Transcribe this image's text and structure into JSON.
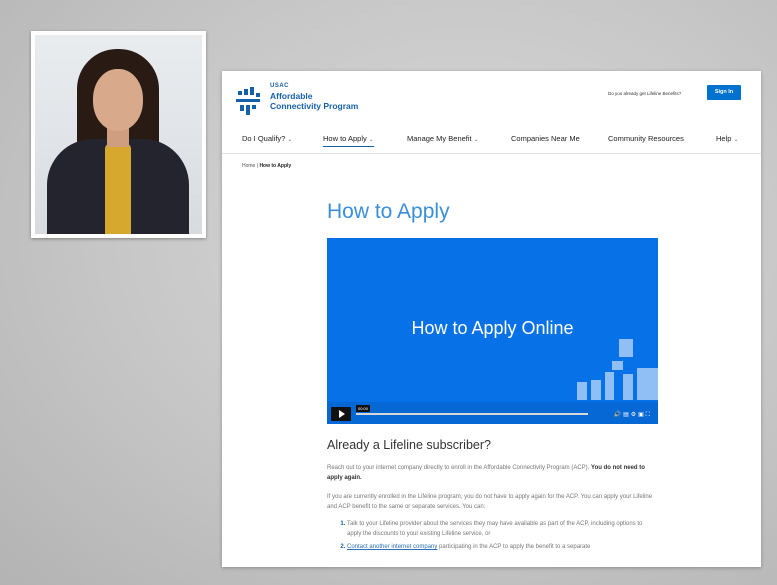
{
  "site": {
    "logo": {
      "org": "USAC",
      "name_line1": "Affordable",
      "name_line2": "Connectivity Program"
    },
    "header_prompt": "Do you already get Lifeline Benefits?",
    "sign_in_label": "Sign In"
  },
  "nav": {
    "items": [
      {
        "label": "Do I Qualify?",
        "dropdown": true
      },
      {
        "label": "How to Apply",
        "dropdown": true,
        "active": true
      },
      {
        "label": "Manage My Benefit",
        "dropdown": true
      },
      {
        "label": "Companies Near Me",
        "dropdown": false
      },
      {
        "label": "Community Resources",
        "dropdown": false
      },
      {
        "label": "Help",
        "dropdown": true
      }
    ]
  },
  "breadcrumb": {
    "home": "Home",
    "separator": "|",
    "current": "How to Apply"
  },
  "main": {
    "title": "How to Apply",
    "video": {
      "title": "How to Apply Online",
      "time": "00:00"
    },
    "section_heading": "Already a Lifeline subscriber?",
    "para1_text": "Reach out to your internet company directly to enroll in the Affordable Connectivity Program (ACP).",
    "para1_bold": "You do not need to apply again.",
    "para2": "If you are currently enrolled in the Lifeline program, you do not have to apply again for the ACP. You can apply your Lifeline and ACP benefit to the same or separate services. You can:",
    "list": [
      {
        "text": "Talk to your Lifeline provider about the services they may have available as part of the ACP, including options to apply the discounts to your existing Lifeline service, or"
      },
      {
        "link": "Contact another internet company",
        "text": " participating in the ACP to apply the benefit to a separate"
      }
    ]
  },
  "colors": {
    "brand_blue": "#1460aa",
    "video_blue": "#0771e8",
    "title_blue": "#3a8fd9",
    "button_blue": "#0071ce"
  }
}
